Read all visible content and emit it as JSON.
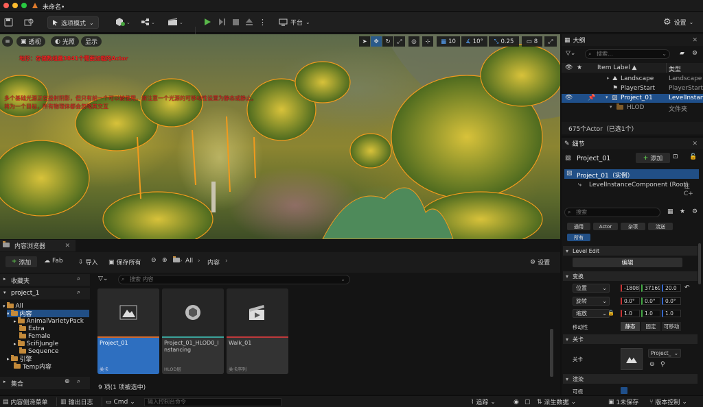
{
  "titlebar": {
    "title": "未命名•"
  },
  "toolbar": {
    "mode": "选项模式",
    "platform": "平台",
    "settings": "设置"
  },
  "viewport": {
    "perspective": "透视",
    "lighting": "光照",
    "show": "显示",
    "grid_snap": "10",
    "rot_snap": "10°",
    "scale_snap": "0.25",
    "cam_speed": "8",
    "warning1": "地形：存储数组量3841个需要加载的Actor",
    "warning2": "多个基础光源正在投射阴影，但只有前一个可以被使用。请注意一个光源的可移动性设置为静态或静止。",
    "warning3": "将为一个目标，所有物理体都会忽略其交互"
  },
  "outliner": {
    "title": "大纲",
    "search_placeholder": "搜索...",
    "col_label": "Item Label ▲",
    "col_type": "类型",
    "rows": [
      {
        "name": "Landscape",
        "type": "Landscape"
      },
      {
        "name": "PlayerStart",
        "type": "PlayerStart"
      },
      {
        "name": "Project_01",
        "type": "LevelInstance"
      },
      {
        "name": "HLOD",
        "type": "文件夹"
      }
    ],
    "count": "675个Actor（已选1个）"
  },
  "details": {
    "title": "细节",
    "actor": "Project_01",
    "add": "添加",
    "instance": "Project_01（实例）",
    "component": "LevelInstanceComponent (Root)",
    "component_suffix": "在C+",
    "search_placeholder": "搜索",
    "filters": [
      "通用",
      "Actor",
      "杂项",
      "流送",
      "所有"
    ],
    "level_edit": "Level Edit",
    "edit_button": "编辑",
    "transform": "变换",
    "location_label": "位置",
    "location": [
      "-1808",
      "37169",
      "20.0"
    ],
    "rotation_label": "旋转",
    "rotation": [
      "0.0°",
      "0.0°",
      "0.0°"
    ],
    "scale_label": "缩放",
    "scale": [
      "1.0",
      "1.0",
      "1.0"
    ],
    "mobility_label": "移动性",
    "mobility": [
      "静态",
      "固定",
      "可移动"
    ],
    "level_cat": "关卡",
    "level_label": "关卡",
    "level_value": "Project_",
    "render_cat": "渲染",
    "visible_label": "可视"
  },
  "content_browser": {
    "tab": "内容浏览器",
    "add": "添加",
    "fab": "Fab",
    "import": "导入",
    "save_all": "保存所有",
    "path": [
      "All",
      "内容"
    ],
    "settings": "设置",
    "favorites": "收藏夹",
    "project": "project_1",
    "tree": [
      "All",
      "内容",
      "AnimalVarietyPack",
      "Extra",
      "Female",
      "ScifiJungle",
      "Sequence",
      "引擎",
      "Temp内容"
    ],
    "collections": "集合",
    "search_placeholder": "搜索 内容",
    "assets": [
      {
        "name": "Project_01",
        "type": "关卡",
        "color": "#d16a2e"
      },
      {
        "name": "Project_01_HLOD0_Instancing",
        "type": "HLOD层",
        "color": "#3aa39a"
      },
      {
        "name": "Walk_01",
        "type": "关卡序列",
        "color": "#c0393b"
      }
    ],
    "count": "9 项(1 项被选中)"
  },
  "statusbar": {
    "drawer": "内容侧滑菜单",
    "output": "输出日志",
    "cmd": "Cmd",
    "console_placeholder": "输入控制台命令",
    "trace": "追踪",
    "derived": "派生数据",
    "unsaved": "1未保存",
    "source": "版本控制"
  }
}
